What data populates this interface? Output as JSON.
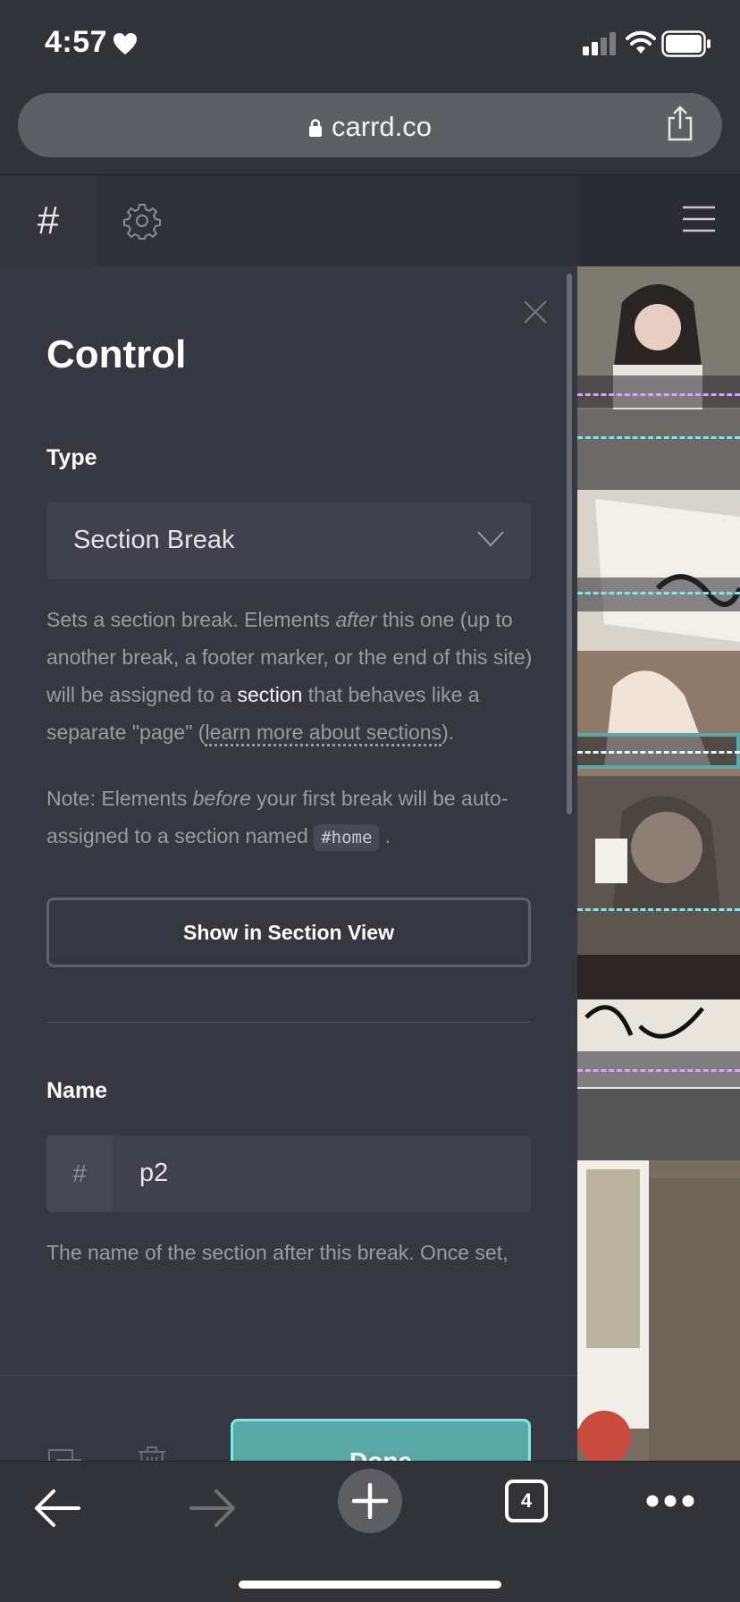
{
  "status": {
    "time": "4:57"
  },
  "browser": {
    "url": "carrd.co",
    "tab_count": "4"
  },
  "panel": {
    "title": "Control",
    "type_label": "Type",
    "type_value": "Section Break",
    "desc1_a": "Sets a section break. Elements ",
    "desc1_em": "after",
    "desc1_b": " this one (up to another break, a footer marker, or the end of this site) will be assigned to a ",
    "desc1_section": "section",
    "desc1_c": " that behaves like a separate \"page\" (",
    "desc1_link": "learn more about sections",
    "desc1_d": ").",
    "note_a": "Note: Elements ",
    "note_em": "before",
    "note_b": " your first break will be auto-assigned to a section named ",
    "note_code": "#home",
    "note_c": " .",
    "show_button": "Show in Section View",
    "name_label": "Name",
    "name_prefix": "#",
    "name_value": "p2",
    "name_help": "The name of the section after this break. Once set,",
    "done_button": "Done"
  },
  "colors": {
    "accent": "#5aa8a6",
    "accent_border": "#78ecea",
    "panel_bg": "#363741"
  }
}
